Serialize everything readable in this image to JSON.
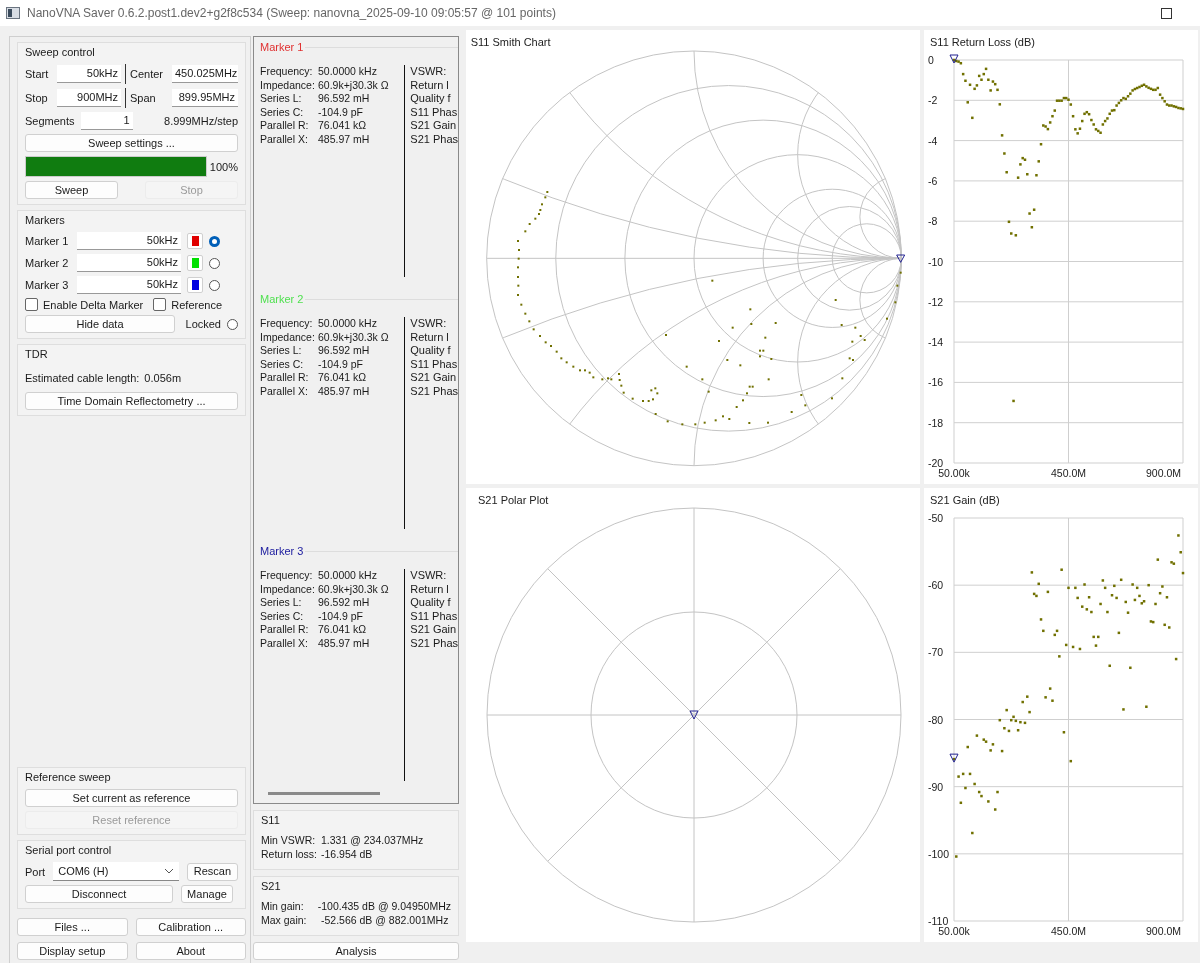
{
  "window": {
    "title": "NanoVNA Saver 0.6.2.post1.dev2+g2f8c534 (Sweep: nanovna_2025-09-10 09:05:57 @ 101 points)"
  },
  "sweep_control": {
    "title": "Sweep control",
    "start": {
      "label": "Start",
      "value": "50kHz"
    },
    "stop": {
      "label": "Stop",
      "value": "900MHz"
    },
    "center": {
      "label": "Center",
      "value": "450.025MHz"
    },
    "span": {
      "label": "Span",
      "value": "899.95MHz"
    },
    "segments": {
      "label": "Segments",
      "value": "1"
    },
    "step": "8.999MHz/step",
    "settings_button": "Sweep settings ...",
    "progress": {
      "level": 1.0,
      "reading": "100%"
    },
    "sweep_button": {
      "label": "Sweep",
      "disabled": false
    },
    "stop_button": {
      "label": "Stop",
      "disabled": true
    }
  },
  "markers": {
    "title": "Markers",
    "items": [
      {
        "label": "Marker 1",
        "value": "50kHz",
        "color": "#e00000",
        "selected": true
      },
      {
        "label": "Marker 2",
        "value": "50kHz",
        "color": "#00e000",
        "selected": false
      },
      {
        "label": "Marker 3",
        "value": "50kHz",
        "color": "#0000e0",
        "selected": false
      }
    ],
    "delta": {
      "label": "Enable Delta Marker",
      "checked": false
    },
    "reference": {
      "label": "Reference",
      "checked": false
    },
    "hide_button": "Hide data",
    "locked": {
      "label": "Locked",
      "checked": false
    }
  },
  "tdr": {
    "title": "TDR",
    "cable_length": {
      "label": "Estimated cable length:",
      "value": "0.056m"
    },
    "button": "Time Domain Reflectometry ..."
  },
  "reference_sweep": {
    "title": "Reference sweep",
    "buttons": [
      {
        "label": "Set current as reference",
        "disabled": false
      },
      {
        "label": "Reset reference",
        "disabled": true
      }
    ]
  },
  "serial_port": {
    "title": "Serial port control",
    "port_label": "Port",
    "port_value": "COM6 (H)",
    "rescan": "Rescan",
    "disconnect": "Disconnect",
    "manage": "Manage"
  },
  "bottom_buttons": [
    "Files ...",
    "Calibration ...",
    "Display setup",
    "About"
  ],
  "marker_panels": [
    {
      "title": "Marker 1",
      "color": "#e03030",
      "fields": [
        {
          "label": "Frequency:",
          "value": "50.0000 kHz"
        },
        {
          "label": "Impedance:",
          "value": "60.9k+j30.3k Ω"
        },
        {
          "label": "Series L:",
          "value": "96.592 mH"
        },
        {
          "label": "Series C:",
          "value": "-104.9 pF"
        },
        {
          "label": "Parallel R:",
          "value": "76.041 kΩ"
        },
        {
          "label": "Parallel X:",
          "value": "485.97 mH"
        }
      ],
      "column_2_labels": [
        "VSWR:",
        "Return l",
        "Quality f",
        "S11 Phas",
        "S21 Gain",
        "S21 Phas"
      ]
    },
    {
      "title": "Marker 2",
      "color": "#50e050",
      "fields": [
        {
          "label": "Frequency:",
          "value": "50.0000 kHz"
        },
        {
          "label": "Impedance:",
          "value": "60.9k+j30.3k Ω"
        },
        {
          "label": "Series L:",
          "value": "96.592 mH"
        },
        {
          "label": "Series C:",
          "value": "-104.9 pF"
        },
        {
          "label": "Parallel R:",
          "value": "76.041 kΩ"
        },
        {
          "label": "Parallel X:",
          "value": "485.97 mH"
        }
      ],
      "column_2_labels": [
        "VSWR:",
        "Return l",
        "Quality f",
        "S11 Phas",
        "S21 Gain",
        "S21 Phas"
      ]
    },
    {
      "title": "Marker 3",
      "color": "#2020a0",
      "fields": [
        {
          "label": "Frequency:",
          "value": "50.0000 kHz"
        },
        {
          "label": "Impedance:",
          "value": "60.9k+j30.3k Ω"
        },
        {
          "label": "Series L:",
          "value": "96.592 mH"
        },
        {
          "label": "Series C:",
          "value": "-104.9 pF"
        },
        {
          "label": "Parallel R:",
          "value": "76.041 kΩ"
        },
        {
          "label": "Parallel X:",
          "value": "485.97 mH"
        }
      ],
      "column_2_labels": [
        "VSWR:",
        "Return l",
        "Quality f",
        "S11 Phas",
        "S21 Gain",
        "S21 Phas"
      ]
    }
  ],
  "s11": {
    "title": "S11",
    "rows": [
      {
        "label": "Min VSWR:",
        "value": "1.331 @ 234.037MHz"
      },
      {
        "label": "Return loss:",
        "value": "-16.954 dB"
      }
    ]
  },
  "s21": {
    "title": "S21",
    "rows": [
      {
        "label": "Min gain:",
        "value": "-100.435 dB @ 9.04950MHz"
      },
      {
        "label": "Max gain:",
        "value": "-52.566 dB @ 882.001MHz"
      }
    ]
  },
  "analysis_button": "Analysis",
  "charts": [
    {
      "kind": "smith",
      "title": "S11 Smith Chart"
    },
    {
      "kind": "scatter",
      "title": "S11 Return Loss (dB)",
      "chart_data": {
        "type": "scatter",
        "grid": true,
        "x": [
          50000,
          9049500,
          18049000,
          27048500,
          36048000,
          45047500,
          54047000,
          63046500,
          72046000,
          81045500,
          90045000,
          99044500,
          108044000,
          117043500,
          126043000,
          135042500,
          144042000,
          153041500,
          162041000,
          171040500,
          180040000,
          189039500,
          198039000,
          207038500,
          216038000,
          225037500,
          234037000,
          243036500,
          252036000,
          261035500,
          270035000,
          279034500,
          288034000,
          297033500,
          306033000,
          315032500,
          324032000,
          333031500,
          342031000,
          351030500,
          360030000,
          369029500,
          378029000,
          387028500,
          396028000,
          405027500,
          414027000,
          423026500,
          432026000,
          441025500,
          450025000,
          459024500,
          468024000,
          477023500,
          486023000,
          495022500,
          504022000,
          513021500,
          522021000,
          531020500,
          540020000,
          549019500,
          558019000,
          567018500,
          576018000,
          585017500,
          594017000,
          603016500,
          612016000,
          621015500,
          630015000,
          639014500,
          648014000,
          657013500,
          666013000,
          675012500,
          684012000,
          693011500,
          702011000,
          711010500,
          720010000,
          729009500,
          738009000,
          747008500,
          756008000,
          765007500,
          774007000,
          783006500,
          792006000,
          801005500,
          810005000,
          819004500,
          828004000,
          837003500,
          846003000,
          855002500,
          864002000,
          873001500,
          882001000,
          891000500,
          900000000
        ],
        "series": [
          {
            "color": "#707000",
            "values": [
              0,
              -0.05,
              -0.08,
              -0.16,
              -0.7,
              -1.03,
              -2.1,
              -1.23,
              -2.87,
              -1.43,
              -1.26,
              -0.79,
              -0.98,
              -0.7,
              -0.44,
              -0.98,
              -1.51,
              -1.07,
              -1.2,
              -1.48,
              -2.2,
              -3.74,
              -4.64,
              -5.57,
              -8.03,
              -8.61,
              -16.92,
              -8.7,
              -5.84,
              -5.18,
              -4.87,
              -4.95,
              -5.67,
              -7.62,
              -8.3,
              -7.43,
              -5.72,
              -5.03,
              -4.18,
              -3.25,
              -3.3,
              -3.43,
              -3.1,
              -2.79,
              -2.51,
              -2.02,
              -2.02,
              -2.02,
              -1.89,
              -1.89,
              -1.97,
              -2.21,
              -2.79,
              -3.44,
              -3.64,
              -3.41,
              -3.03,
              -2.67,
              -2.59,
              -2.69,
              -2.98,
              -3.2,
              -3.44,
              -3.52,
              -3.61,
              -3.2,
              -3.03,
              -2.9,
              -2.67,
              -2.51,
              -2.49,
              -2.26,
              -2.13,
              -2.0,
              -1.89,
              -1.93,
              -1.8,
              -1.67,
              -1.51,
              -1.44,
              -1.39,
              -1.34,
              -1.28,
              -1.23,
              -1.31,
              -1.38,
              -1.43,
              -1.48,
              -1.48,
              -1.39,
              -1.72,
              -1.89,
              -2.05,
              -2.21,
              -2.26,
              -2.26,
              -2.3,
              -2.33,
              -2.38,
              -2.4,
              -2.43
            ]
          }
        ],
        "xlim": [
          50000,
          900000000
        ],
        "ylim": [
          -20,
          0
        ],
        "xticks": [
          {
            "value": 50000,
            "label": "50.00k"
          },
          {
            "value": 450000000,
            "label": "450.0M"
          },
          {
            "value": 900000000,
            "label": "900.0M"
          }
        ],
        "yticks": [
          0,
          -2,
          -4,
          -6,
          -8,
          -10,
          -12,
          -14,
          -16,
          -18,
          -20
        ]
      }
    },
    {
      "kind": "polar",
      "title": "S21 Polar Plot"
    },
    {
      "kind": "scatter",
      "title": "S21 Gain (dB)",
      "chart_data": {
        "type": "scatter",
        "grid": true,
        "x": [
          50000,
          9049500,
          18049000,
          27048500,
          36048000,
          45047500,
          54047000,
          63046500,
          72046000,
          81045500,
          90045000,
          99044500,
          108044000,
          117043500,
          126043000,
          135042500,
          144042000,
          153041500,
          162041000,
          171040500,
          180040000,
          189039500,
          198039000,
          207038500,
          216038000,
          225037500,
          234037000,
          243036500,
          252036000,
          261035500,
          270035000,
          279034500,
          288034000,
          297033500,
          306033000,
          315032500,
          324032000,
          333031500,
          342031000,
          351030500,
          360030000,
          369029500,
          378029000,
          387028500,
          396028000,
          405027500,
          414027000,
          423026500,
          432026000,
          441025500,
          450025000,
          459024500,
          468024000,
          477023500,
          486023000,
          495022500,
          504022000,
          513021500,
          522021000,
          531020500,
          540020000,
          549019500,
          558019000,
          567018500,
          576018000,
          585017500,
          594017000,
          603016500,
          612016000,
          621015500,
          630015000,
          639014500,
          648014000,
          657013500,
          666013000,
          675012500,
          684012000,
          693011500,
          702011000,
          711010500,
          720010000,
          729009500,
          738009000,
          747008500,
          756008000,
          765007500,
          774007000,
          783006500,
          792006000,
          801005500,
          810005000,
          819004500,
          828004000,
          837003500,
          846003000,
          855002500,
          864002000,
          873001500,
          882001000,
          891000500,
          900000000
        ],
        "series": [
          {
            "color": "#707000",
            "values": [
              -85.9,
              -100.4,
              -88.5,
              -92.4,
              -88.1,
              -90.2,
              -84.1,
              -88.1,
              -96.9,
              -89.6,
              -82.4,
              -90.8,
              -91.4,
              -83.0,
              -83.3,
              -92.2,
              -84.6,
              -83.7,
              -93.4,
              -90.8,
              -80.1,
              -84.7,
              -81.3,
              -78.6,
              -81.7,
              -80.1,
              -79.6,
              -80.2,
              -81.6,
              -80.4,
              -77.4,
              -80.5,
              -76.6,
              -78.9,
              -58.1,
              -61.3,
              -61.6,
              -59.8,
              -65.1,
              -66.8,
              -76.7,
              -61.0,
              -75.4,
              -77.2,
              -67.4,
              -66.8,
              -70.6,
              -57.7,
              -81.9,
              -68.9,
              -60.4,
              -86.2,
              -69.2,
              -60.4,
              -61.9,
              -69.5,
              -63.2,
              -59.9,
              -63.6,
              -61.8,
              -64.0,
              -67.7,
              -69.0,
              -67.7,
              -62.8,
              -59.3,
              -60.4,
              -64.0,
              -72.0,
              -61.5,
              -60.1,
              -61.9,
              -67.1,
              -59.2,
              -78.5,
              -62.5,
              -64.1,
              -72.3,
              -59.9,
              -62.2,
              -60.4,
              -61.6,
              -62.7,
              -62.4,
              -78.1,
              -60.0,
              -65.4,
              -65.5,
              -62.8,
              -56.2,
              -61.2,
              -60.2,
              -65.9,
              -61.8,
              -66.3,
              -56.6,
              -56.8,
              -71.0,
              -52.6,
              -55.1,
              -58.2
            ]
          }
        ],
        "xlim": [
          50000,
          900000000
        ],
        "ylim": [
          -110,
          -50
        ],
        "xticks": [
          {
            "value": 50000,
            "label": "50.00k"
          },
          {
            "value": 450000000,
            "label": "450.0M"
          },
          {
            "value": 900000000,
            "label": "900.0M"
          }
        ],
        "yticks": [
          -50,
          -60,
          -70,
          -80,
          -90,
          -100,
          -110
        ]
      }
    }
  ]
}
